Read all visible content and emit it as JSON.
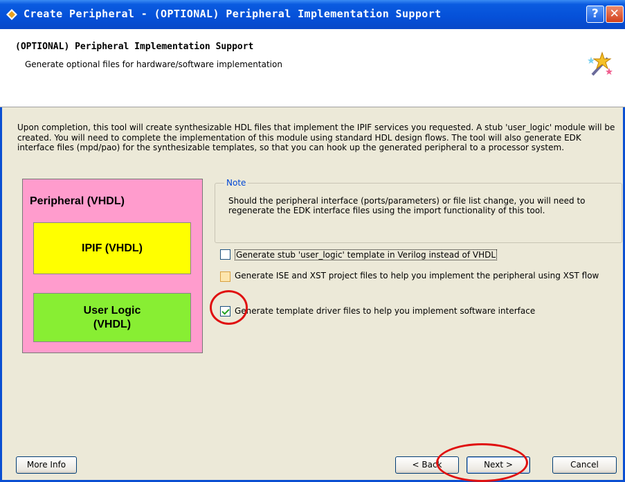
{
  "window": {
    "title": "Create Peripheral - (OPTIONAL) Peripheral Implementation Support",
    "help_glyph": "?",
    "close_glyph": "✕"
  },
  "header": {
    "title": "(OPTIONAL) Peripheral Implementation Support",
    "subtitle": "Generate optional files for hardware/software implementation",
    "icon": "wizard-sparkle-icon"
  },
  "description": "Upon completion, this tool will create synthesizable HDL files that implement the IPIF services you requested. A stub 'user_logic' module will be created. You will need to complete the implementation of this module using standard HDL design flows. The tool will also generate EDK interface files (mpd/pao) for the synthesizable templates, so that you can hook up the generated peripheral to a processor system.",
  "diagram": {
    "peripheral_label": "Peripheral (VHDL)",
    "ipif_label": "IPIF (VHDL)",
    "user_logic_label": "User Logic (VHDL)",
    "colors": {
      "peripheral": "#ff9ccd",
      "ipif": "#ffff00",
      "user_logic": "#88ee33"
    }
  },
  "note": {
    "legend": "Note",
    "text": "Should the peripheral interface (ports/parameters) or file list change, you will need to regenerate the EDK interface files using the import functionality of this tool."
  },
  "options": [
    {
      "label": "Generate stub 'user_logic' template in Verilog instead of VHDL",
      "checked": false,
      "enabled": true
    },
    {
      "label": "Generate ISE and XST project files to help you implement the peripheral using XST flow",
      "checked": false,
      "enabled": false
    },
    {
      "label": "Generate template driver files to help you implement software interface",
      "checked": true,
      "enabled": true
    }
  ],
  "buttons": {
    "more_info": "More Info",
    "back": "< Back",
    "next": "Next >",
    "cancel": "Cancel"
  },
  "annotation_color": "#e01010"
}
